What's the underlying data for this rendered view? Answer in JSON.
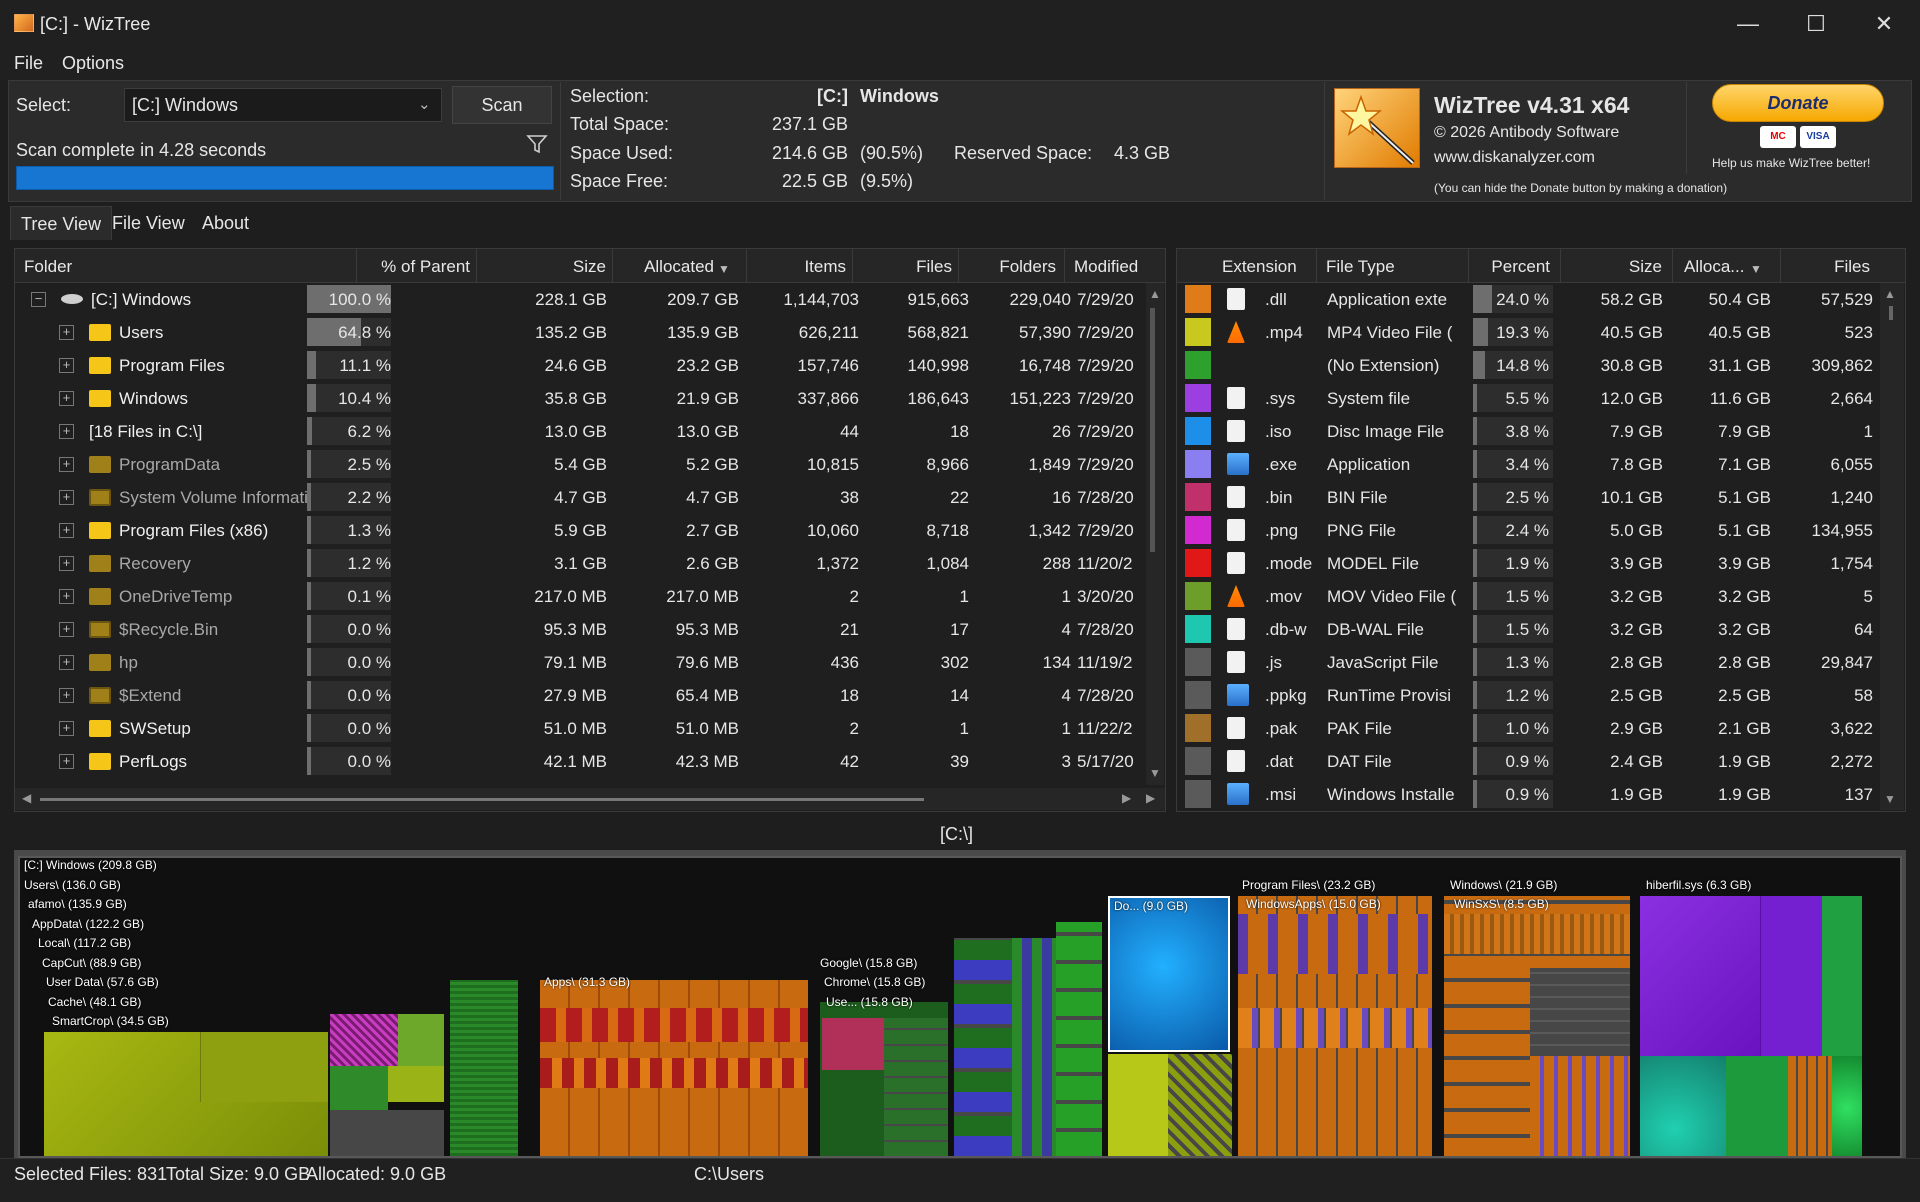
{
  "window": {
    "title": "[C:]  - WizTree",
    "app_icon": "wiztree-icon",
    "controls": [
      "minimize-icon",
      "maximize-icon",
      "close-icon"
    ]
  },
  "menu": [
    "File",
    "Options"
  ],
  "scan": {
    "select_label": "Select:",
    "select_value": "[C:] Windows",
    "scan_button": "Scan",
    "status": "Scan complete in 4.28 seconds",
    "progress": 1.0
  },
  "selection": {
    "label": "Selection:",
    "drive": "[C:]",
    "name": "Windows",
    "total_space_label": "Total Space:",
    "total_space": "237.1 GB",
    "space_used_label": "Space Used:",
    "space_used": "214.6 GB",
    "space_used_pct": "(90.5%)",
    "space_free_label": "Space Free:",
    "space_free": "22.5 GB",
    "space_free_pct": "(9.5%)",
    "reserved_label": "Reserved Space:",
    "reserved": "4.3 GB"
  },
  "about": {
    "app_name": "WizTree v4.31 x64",
    "copyright": "© 2026 Antibody Software",
    "website": "www.diskanalyzer.com",
    "hide_donate_note": "(You can hide the Donate button by making a donation)",
    "donate_label": "Donate",
    "card_mastercard": "MC",
    "card_visa": "VISA",
    "help_text": "Help us make WizTree better!"
  },
  "tabs": [
    "Tree View",
    "File View",
    "About"
  ],
  "tree": {
    "columns": [
      "Folder",
      "% of Parent",
      "Size",
      "Allocated",
      "Items",
      "Files",
      "Folders",
      "Modified"
    ],
    "rows": [
      {
        "name": "[C:] Windows",
        "pct": "100.0 %",
        "pct_value": 100.0,
        "size": "228.1 GB",
        "allocated": "209.7 GB",
        "items": "1,144,703",
        "files": "915,663",
        "folders": "229,040",
        "modified": "7/29/20",
        "icon": "drive-icon",
        "expander": "−"
      },
      {
        "name": "Users",
        "pct": "64.8 %",
        "pct_value": 64.8,
        "size": "135.2 GB",
        "allocated": "135.9 GB",
        "items": "626,211",
        "files": "568,821",
        "folders": "57,390",
        "modified": "7/29/20",
        "icon": "folder-icon",
        "expander": "+"
      },
      {
        "name": "Program Files",
        "pct": "11.1 %",
        "pct_value": 11.1,
        "size": "24.6 GB",
        "allocated": "23.2 GB",
        "items": "157,746",
        "files": "140,998",
        "folders": "16,748",
        "modified": "7/29/20",
        "icon": "folder-icon",
        "expander": "+"
      },
      {
        "name": "Windows",
        "pct": "10.4 %",
        "pct_value": 10.4,
        "size": "35.8 GB",
        "allocated": "21.9 GB",
        "items": "337,866",
        "files": "186,643",
        "folders": "151,223",
        "modified": "7/29/20",
        "icon": "folder-icon",
        "expander": "+"
      },
      {
        "name": "[18 Files in C:\\]",
        "pct": "6.2 %",
        "pct_value": 6.2,
        "size": "13.0 GB",
        "allocated": "13.0 GB",
        "items": "44",
        "files": "18",
        "folders": "26",
        "modified": "7/29/20",
        "icon": "",
        "expander": "+"
      },
      {
        "name": "ProgramData",
        "pct": "2.5 %",
        "pct_value": 2.5,
        "size": "5.4 GB",
        "allocated": "5.2 GB",
        "items": "10,815",
        "files": "8,966",
        "folders": "1,849",
        "modified": "7/29/20",
        "icon": "folder-dim-icon",
        "expander": "+"
      },
      {
        "name": "System Volume Information",
        "pct": "2.2 %",
        "pct_value": 2.2,
        "size": "4.7 GB",
        "allocated": "4.7 GB",
        "items": "38",
        "files": "22",
        "folders": "16",
        "modified": "7/28/20",
        "icon": "system-folder-icon",
        "expander": "+"
      },
      {
        "name": "Program Files (x86)",
        "pct": "1.3 %",
        "pct_value": 1.3,
        "size": "5.9 GB",
        "allocated": "2.7 GB",
        "items": "10,060",
        "files": "8,718",
        "folders": "1,342",
        "modified": "7/29/20",
        "icon": "folder-icon",
        "expander": "+"
      },
      {
        "name": "Recovery",
        "pct": "1.2 %",
        "pct_value": 1.2,
        "size": "3.1 GB",
        "allocated": "2.6 GB",
        "items": "1,372",
        "files": "1,084",
        "folders": "288",
        "modified": "11/20/2",
        "icon": "folder-dim-icon",
        "expander": "+"
      },
      {
        "name": "OneDriveTemp",
        "pct": "0.1 %",
        "pct_value": 0.1,
        "size": "217.0 MB",
        "allocated": "217.0 MB",
        "items": "2",
        "files": "1",
        "folders": "1",
        "modified": "3/20/20",
        "icon": "folder-dim-icon",
        "expander": "+"
      },
      {
        "name": "$Recycle.Bin",
        "pct": "0.0 %",
        "pct_value": 0.0,
        "size": "95.3 MB",
        "allocated": "95.3 MB",
        "items": "21",
        "files": "17",
        "folders": "4",
        "modified": "7/28/20",
        "icon": "system-folder-icon",
        "expander": "+"
      },
      {
        "name": "hp",
        "pct": "0.0 %",
        "pct_value": 0.0,
        "size": "79.1 MB",
        "allocated": "79.6 MB",
        "items": "436",
        "files": "302",
        "folders": "134",
        "modified": "11/19/2",
        "icon": "folder-dim-icon",
        "expander": "+"
      },
      {
        "name": "$Extend",
        "pct": "0.0 %",
        "pct_value": 0.0,
        "size": "27.9 MB",
        "allocated": "65.4 MB",
        "items": "18",
        "files": "14",
        "folders": "4",
        "modified": "7/28/20",
        "icon": "system-folder-icon",
        "expander": "+"
      },
      {
        "name": "SWSetup",
        "pct": "0.0 %",
        "pct_value": 0.0,
        "size": "51.0 MB",
        "allocated": "51.0 MB",
        "items": "2",
        "files": "1",
        "folders": "1",
        "modified": "11/22/2",
        "icon": "folder-icon",
        "expander": "+"
      },
      {
        "name": "PerfLogs",
        "pct": "0.0 %",
        "pct_value": 0.0,
        "size": "42.1 MB",
        "allocated": "42.3 MB",
        "items": "42",
        "files": "39",
        "folders": "3",
        "modified": "5/17/20",
        "icon": "folder-icon",
        "expander": "+"
      }
    ]
  },
  "extensions": {
    "columns": [
      "Extension",
      "File Type",
      "Percent",
      "Size",
      "Alloca...",
      "Files"
    ],
    "rows": [
      {
        "color": "#e07b1a",
        "icon": "dll-file-icon",
        "ext": ".dll",
        "type": "Application exte",
        "pct": "24.0 %",
        "pct_value": 24.0,
        "size": "58.2 GB",
        "alloc": "50.4 GB",
        "files": "57,529"
      },
      {
        "color": "#c8c81e",
        "icon": "vlc-cone-icon",
        "ext": ".mp4",
        "type": "MP4 Video File (",
        "pct": "19.3 %",
        "pct_value": 19.3,
        "size": "40.5 GB",
        "alloc": "40.5 GB",
        "files": "523"
      },
      {
        "color": "#2ea02e",
        "icon": "",
        "ext": "",
        "type": "(No Extension)",
        "pct": "14.8 %",
        "pct_value": 14.8,
        "size": "30.8 GB",
        "alloc": "31.1 GB",
        "files": "309,862"
      },
      {
        "color": "#9b3fe0",
        "icon": "sys-file-icon",
        "ext": ".sys",
        "type": "System file",
        "pct": "5.5 %",
        "pct_value": 5.5,
        "size": "12.0 GB",
        "alloc": "11.6 GB",
        "files": "2,664"
      },
      {
        "color": "#1e8fe8",
        "icon": "iso-file-icon",
        "ext": ".iso",
        "type": "Disc Image File",
        "pct": "3.8 %",
        "pct_value": 3.8,
        "size": "7.9 GB",
        "alloc": "7.9 GB",
        "files": "1"
      },
      {
        "color": "#8a7ef0",
        "icon": "exe-file-icon",
        "ext": ".exe",
        "type": "Application",
        "pct": "3.4 %",
        "pct_value": 3.4,
        "size": "7.8 GB",
        "alloc": "7.1 GB",
        "files": "6,055"
      },
      {
        "color": "#c0306a",
        "icon": "bin-file-icon",
        "ext": ".bin",
        "type": "BIN File",
        "pct": "2.5 %",
        "pct_value": 2.5,
        "size": "10.1 GB",
        "alloc": "5.1 GB",
        "files": "1,240"
      },
      {
        "color": "#d02ad0",
        "icon": "png-file-icon",
        "ext": ".png",
        "type": "PNG File",
        "pct": "2.4 %",
        "pct_value": 2.4,
        "size": "5.0 GB",
        "alloc": "5.1 GB",
        "files": "134,955"
      },
      {
        "color": "#e01818",
        "icon": "model-file-icon",
        "ext": ".mode",
        "type": "MODEL File",
        "pct": "1.9 %",
        "pct_value": 1.9,
        "size": "3.9 GB",
        "alloc": "3.9 GB",
        "files": "1,754"
      },
      {
        "color": "#6e9e2a",
        "icon": "vlc-cone-icon",
        "ext": ".mov",
        "type": "MOV Video File (",
        "pct": "1.5 %",
        "pct_value": 1.5,
        "size": "3.2 GB",
        "alloc": "3.2 GB",
        "files": "5"
      },
      {
        "color": "#1ec8b0",
        "icon": "dbw-file-icon",
        "ext": ".db-w",
        "type": "DB-WAL File",
        "pct": "1.5 %",
        "pct_value": 1.5,
        "size": "3.2 GB",
        "alloc": "3.2 GB",
        "files": "64"
      },
      {
        "color": "#5a5a5a",
        "icon": "js-file-icon",
        "ext": ".js",
        "type": "JavaScript File",
        "pct": "1.3 %",
        "pct_value": 1.3,
        "size": "2.8 GB",
        "alloc": "2.8 GB",
        "files": "29,847"
      },
      {
        "color": "#5a5a5a",
        "icon": "ppkg-file-icon",
        "ext": ".ppkg",
        "type": "RunTime Provisi",
        "pct": "1.2 %",
        "pct_value": 1.2,
        "size": "2.5 GB",
        "alloc": "2.5 GB",
        "files": "58"
      },
      {
        "color": "#a0702a",
        "icon": "pak-file-icon",
        "ext": ".pak",
        "type": "PAK File",
        "pct": "1.0 %",
        "pct_value": 1.0,
        "size": "2.9 GB",
        "alloc": "2.1 GB",
        "files": "3,622"
      },
      {
        "color": "#5a5a5a",
        "icon": "dat-file-icon",
        "ext": ".dat",
        "type": "DAT File",
        "pct": "0.9 %",
        "pct_value": 0.9,
        "size": "2.4 GB",
        "alloc": "1.9 GB",
        "files": "2,272"
      },
      {
        "color": "#5a5a5a",
        "icon": "msi-file-icon",
        "ext": ".msi",
        "type": "Windows Installe",
        "pct": "0.9 %",
        "pct_value": 0.9,
        "size": "1.9 GB",
        "alloc": "1.9 GB",
        "files": "137"
      }
    ]
  },
  "treemap": {
    "path_label": "[C:\\]",
    "labels": {
      "root": "[C:] Windows  (209.8 GB)",
      "users": "Users\\ (136.0 GB)",
      "afamo": "afamo\\ (135.9 GB)",
      "appdata": "AppData\\ (122.2 GB)",
      "local": "Local\\ (117.2 GB)",
      "capcut": "CapCut\\ (88.9 GB)",
      "userdata": "User Data\\ (57.6 GB)",
      "cache": "Cache\\ (48.1 GB)",
      "smartcrop": "SmartCrop\\ (34.5 GB)",
      "apps": "Apps\\ (31.3 GB)",
      "google": "Google\\ (15.8 GB)",
      "chrome": "Chrome\\ (15.8 GB)",
      "use": "Use... (15.8 GB)",
      "do": "Do... (9.0 GB)",
      "programfiles": "Program Files\\ (23.2 GB)",
      "windowsapps": "WindowsApps\\ (15.0 GB)",
      "windows": "Windows\\ (21.9 GB)",
      "winsxs": "WinSxS\\ (8.5 GB)",
      "hiberfil": "hiberfil.sys (6.3 GB)"
    }
  },
  "status": {
    "selected_files": "Selected Files: 831",
    "total_size": "Total Size: 9.0 GB",
    "allocated": "Allocated: 9.0 GB",
    "path": "C:\\Users"
  }
}
